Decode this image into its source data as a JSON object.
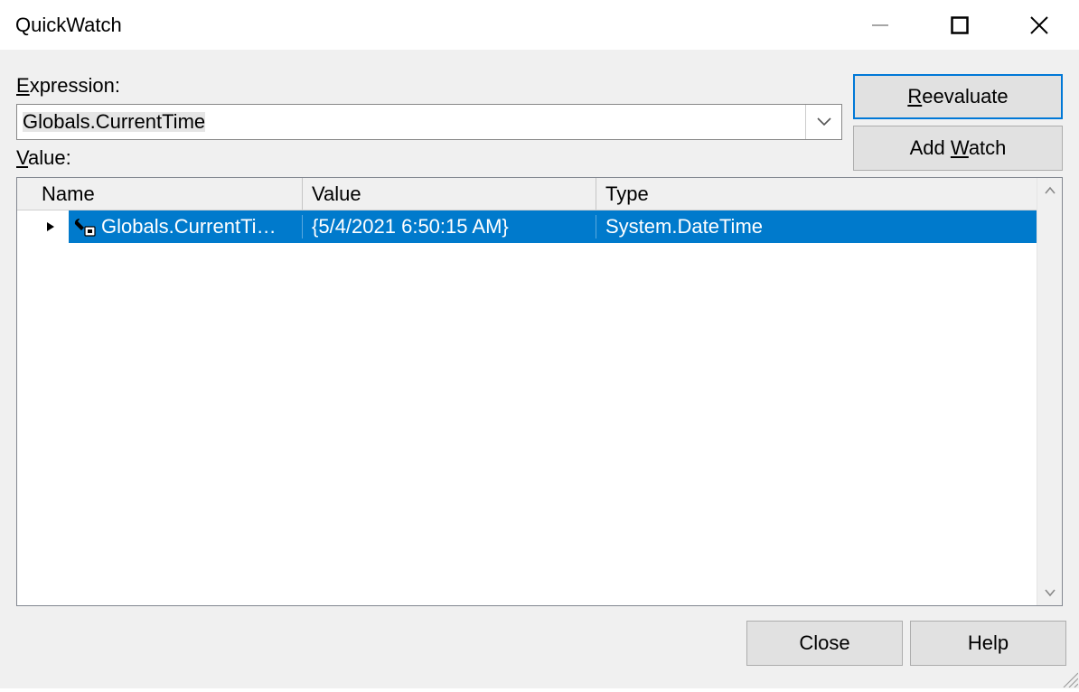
{
  "window": {
    "title": "QuickWatch"
  },
  "labels": {
    "expression_prefix": "E",
    "expression_suffix": "xpression:",
    "value_prefix": "V",
    "value_suffix": "alue:"
  },
  "buttons": {
    "reevaluate_prefix": "R",
    "reevaluate_suffix": "eevaluate",
    "addwatch_prefix": "Add ",
    "addwatch_under": "W",
    "addwatch_suffix": "atch",
    "close": "Close",
    "help": "Help"
  },
  "expression": {
    "value": "Globals.CurrentTime"
  },
  "grid": {
    "headers": {
      "name": "Name",
      "value": "Value",
      "type": "Type"
    },
    "row": {
      "name": "Globals.CurrentTime",
      "name_display": "Globals.CurrentTi…",
      "value": "{5/4/2021 6:50:15 AM}",
      "type": "System.DateTime"
    }
  }
}
